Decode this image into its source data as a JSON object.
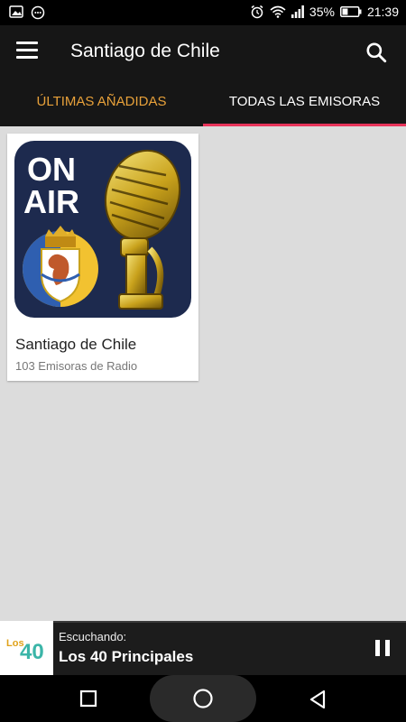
{
  "status_bar": {
    "left_icons": [
      "image-icon",
      "chat-icon"
    ],
    "alarm_icon": "alarm-clock-icon",
    "wifi_icon": "wifi-icon",
    "signal_icon": "signal-icon",
    "battery_percent": "35%",
    "battery_level": 0.35,
    "time": "21:39"
  },
  "app_bar": {
    "menu_icon": "hamburger-menu-icon",
    "title": "Santiago de Chile",
    "search_icon": "search-icon"
  },
  "tabs": [
    {
      "label": "ÚLTIMAS AÑADIDAS",
      "selected": false
    },
    {
      "label": "TODAS LAS EMISORAS",
      "selected": true
    }
  ],
  "cards": [
    {
      "image_label_line1": "ON",
      "image_label_line2": "AIR",
      "title": "Santiago de Chile",
      "subtitle": "103 Emisoras de Radio"
    }
  ],
  "player": {
    "logo_text_small": "Los",
    "logo_text_big": "40",
    "listening_label": "Escuchando:",
    "station": "Los 40 Principales",
    "state_icon": "pause-icon"
  },
  "nav_bar": {
    "recent_icon": "square-recent-apps-icon",
    "home_icon": "circle-home-icon",
    "back_icon": "triangle-back-icon"
  },
  "colors": {
    "accent_tab_text": "#e8a13a",
    "tab_indicator": "#e8345a",
    "app_bar_bg": "#161616",
    "content_bg": "#dcdcdc"
  }
}
